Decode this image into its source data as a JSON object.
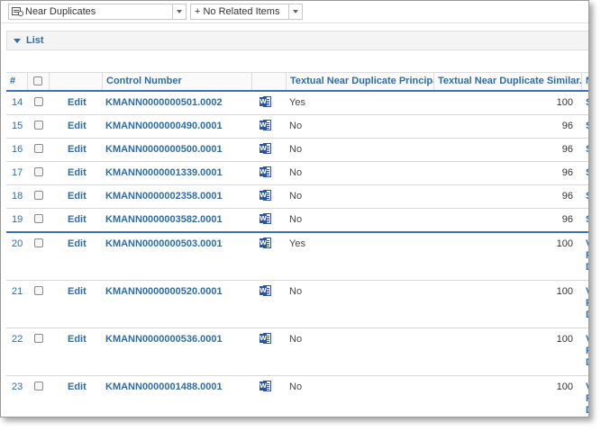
{
  "toolbar": {
    "view_select": "Near Duplicates",
    "related_select": "+ No Related Items"
  },
  "section": {
    "title": "List"
  },
  "columns": {
    "num": "#",
    "control_number": "Control Number",
    "principal": "Textual Near Duplicate Principal",
    "similarity": "Textual Near Duplicate Similar..."
  },
  "rows": [
    {
      "num": "14",
      "edit": "Edit",
      "control": "KMANN0000000501.0002",
      "principal": "Yes",
      "similarity": "100",
      "extra": "S"
    },
    {
      "num": "15",
      "edit": "Edit",
      "control": "KMANN0000000490.0001",
      "principal": "No",
      "similarity": "96",
      "extra": "S"
    },
    {
      "num": "16",
      "edit": "Edit",
      "control": "KMANN0000000500.0001",
      "principal": "No",
      "similarity": "96",
      "extra": "S"
    },
    {
      "num": "17",
      "edit": "Edit",
      "control": "KMANN0000001339.0001",
      "principal": "No",
      "similarity": "96",
      "extra": "S"
    },
    {
      "num": "18",
      "edit": "Edit",
      "control": "KMANN0000002358.0001",
      "principal": "No",
      "similarity": "96",
      "extra": "S"
    },
    {
      "num": "19",
      "edit": "Edit",
      "control": "KMANN0000003582.0001",
      "principal": "No",
      "similarity": "96",
      "extra": "S"
    },
    {
      "num": "20",
      "edit": "Edit",
      "control": "KMANN0000000503.0001",
      "principal": "Yes",
      "similarity": "100",
      "extra": "V"
    },
    {
      "num": "21",
      "edit": "Edit",
      "control": "KMANN0000000520.0001",
      "principal": "No",
      "similarity": "100",
      "extra": "V"
    },
    {
      "num": "22",
      "edit": "Edit",
      "control": "KMANN0000000536.0001",
      "principal": "No",
      "similarity": "100",
      "extra": "V"
    },
    {
      "num": "23",
      "edit": "Edit",
      "control": "KMANN0000001488.0001",
      "principal": "No",
      "similarity": "100",
      "extra": "V"
    }
  ],
  "icons": {
    "view": "grid-view-icon",
    "doc": "word-doc-icon",
    "collapse": "collapse-triangle-icon"
  },
  "colors": {
    "accent": "#2e6da4",
    "group_separator": "#3a72b4"
  }
}
